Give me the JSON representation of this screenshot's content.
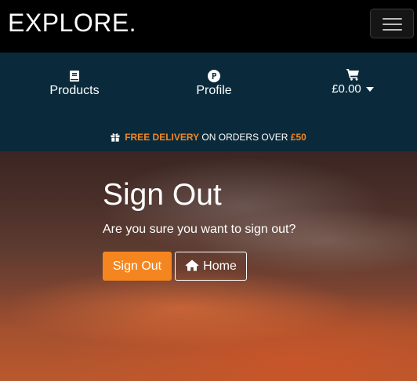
{
  "header": {
    "brand": "EXPLORE.",
    "menu_icon": "hamburger-menu-icon"
  },
  "nav": {
    "products": {
      "label": "Products",
      "icon": "book-icon"
    },
    "profile": {
      "label": "Profile",
      "icon": "circled-p-icon"
    },
    "cart": {
      "total": "£0.00",
      "icon": "shopping-cart-icon"
    }
  },
  "promo": {
    "icon": "gift-icon",
    "highlight": "FREE DELIVERY",
    "middle": " ON ORDERS OVER ",
    "amount": "£50"
  },
  "main": {
    "title": "Sign Out",
    "message": "Are you sure you want to sign out?",
    "signout_label": "Sign Out",
    "home_label": "Home",
    "home_icon": "home-icon"
  },
  "colors": {
    "accent": "#f5861f",
    "nav_bg": "#0a2a3b",
    "topbar_bg": "#000000"
  }
}
